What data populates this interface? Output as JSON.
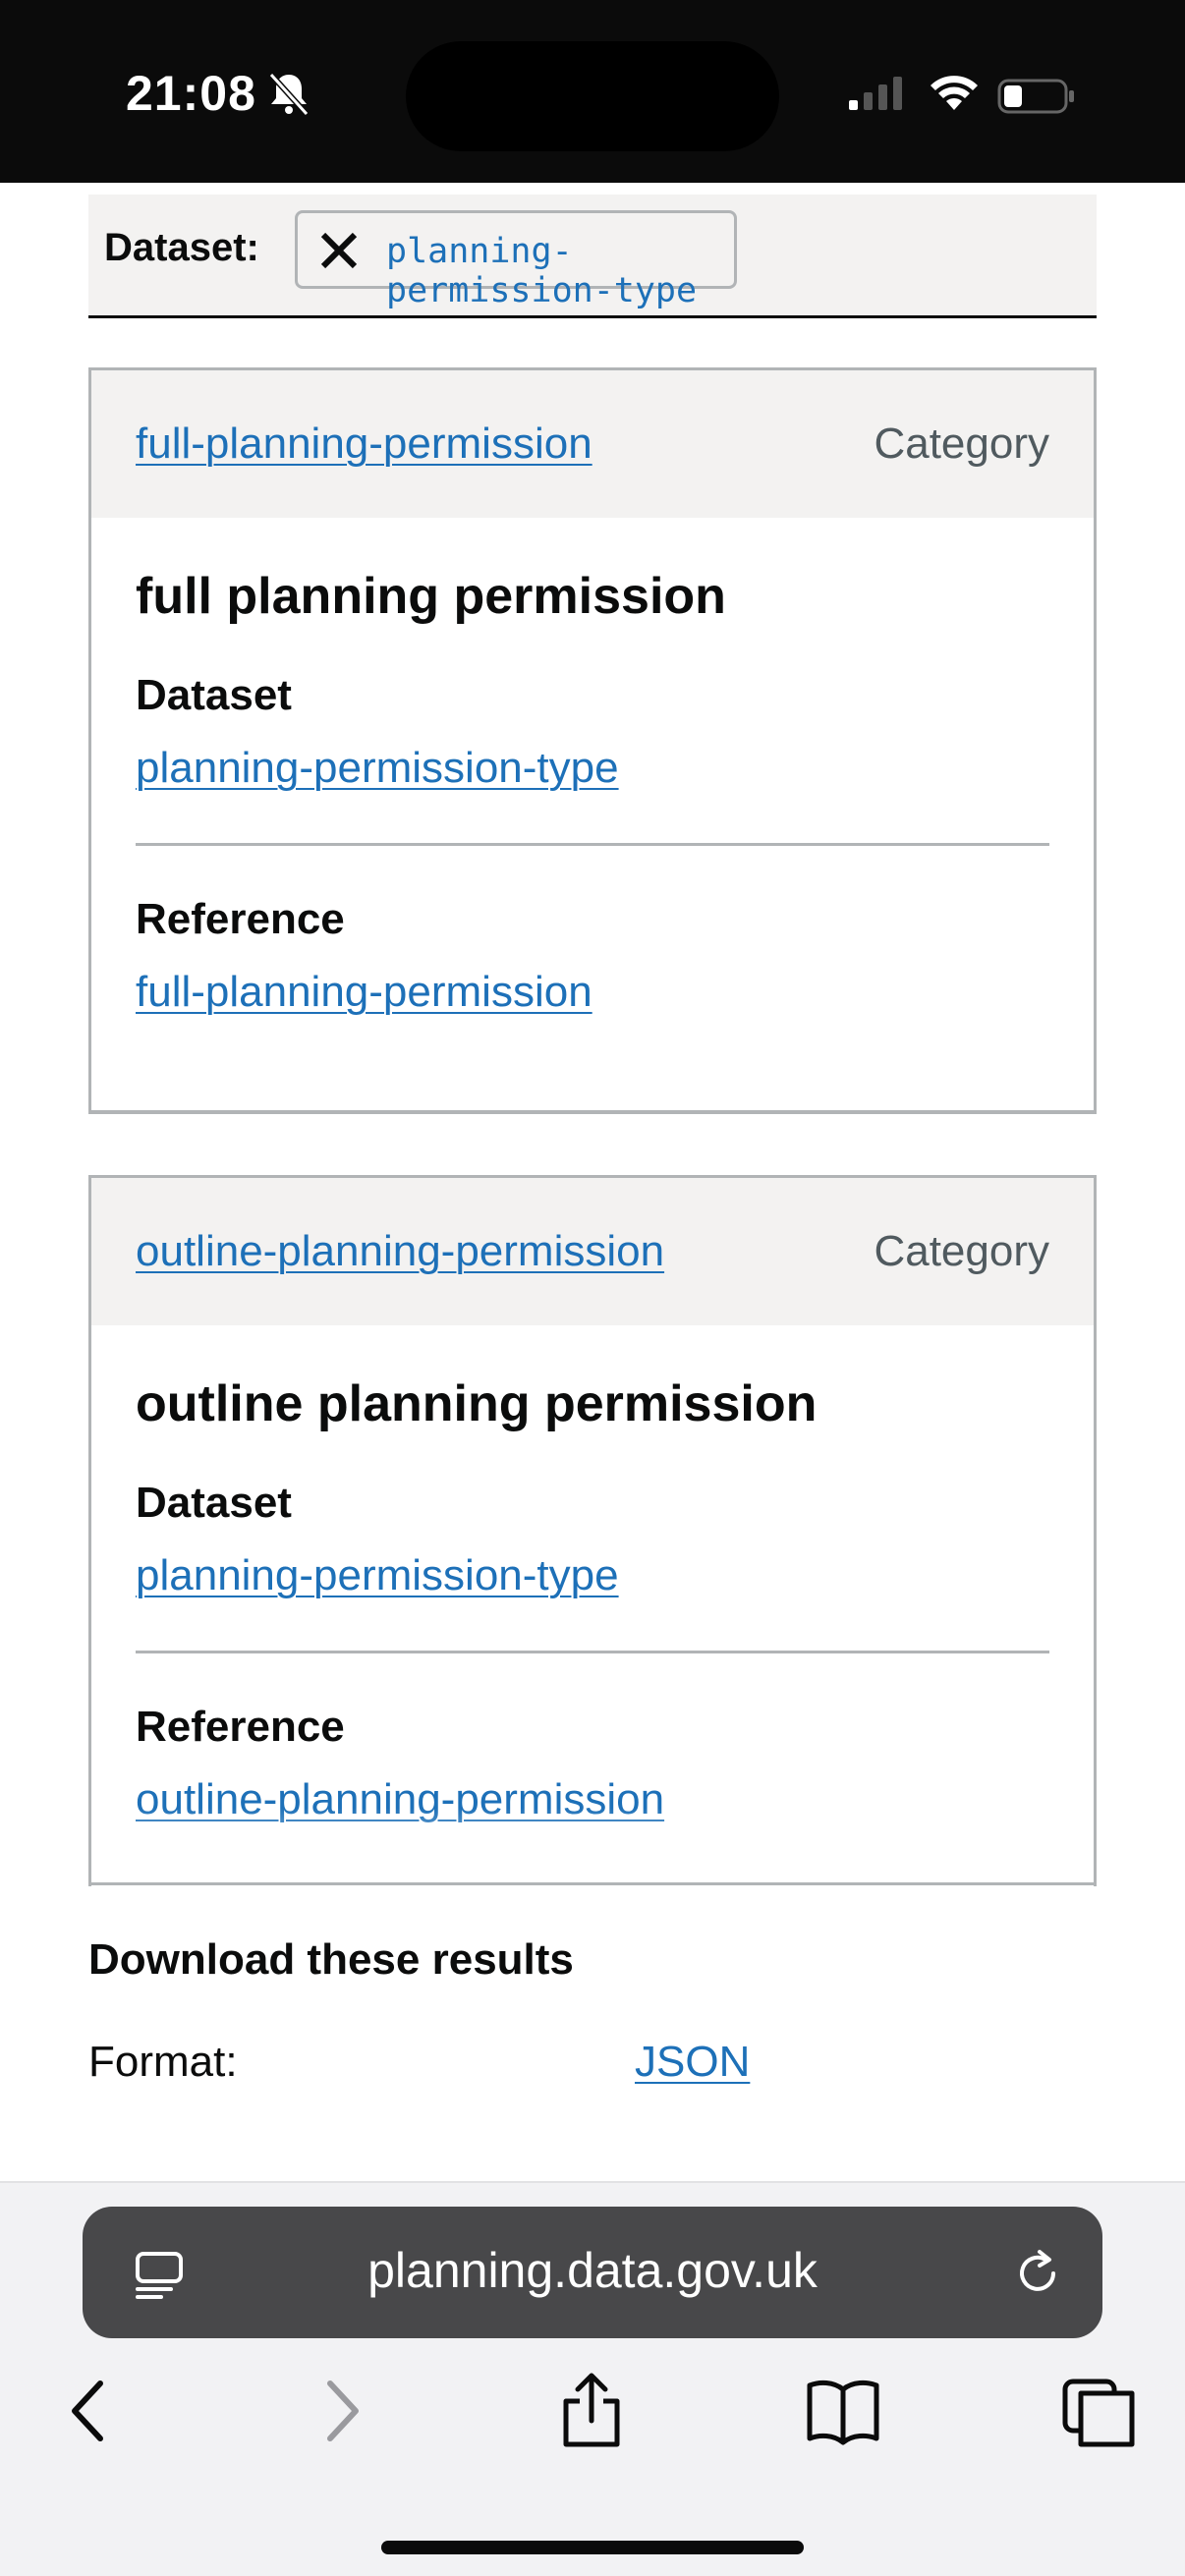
{
  "status_bar": {
    "time": "21:08"
  },
  "filter": {
    "label": "Dataset:",
    "chip_value": "planning-permission-type"
  },
  "results": [
    {
      "header_link": "full-planning-permission",
      "type": "Category",
      "title": "full planning permission",
      "dataset_label": "Dataset",
      "dataset_value": "planning-permission-type",
      "reference_label": "Reference",
      "reference_value": "full-planning-permission"
    },
    {
      "header_link": "outline-planning-permission",
      "type": "Category",
      "title": "outline planning permission",
      "dataset_label": "Dataset",
      "dataset_value": "planning-permission-type",
      "reference_label": "Reference",
      "reference_value": "outline-planning-permission"
    }
  ],
  "download": {
    "heading": "Download these results",
    "format_label": "Format:",
    "format_link": "JSON"
  },
  "browser": {
    "url": "planning.data.gov.uk"
  }
}
